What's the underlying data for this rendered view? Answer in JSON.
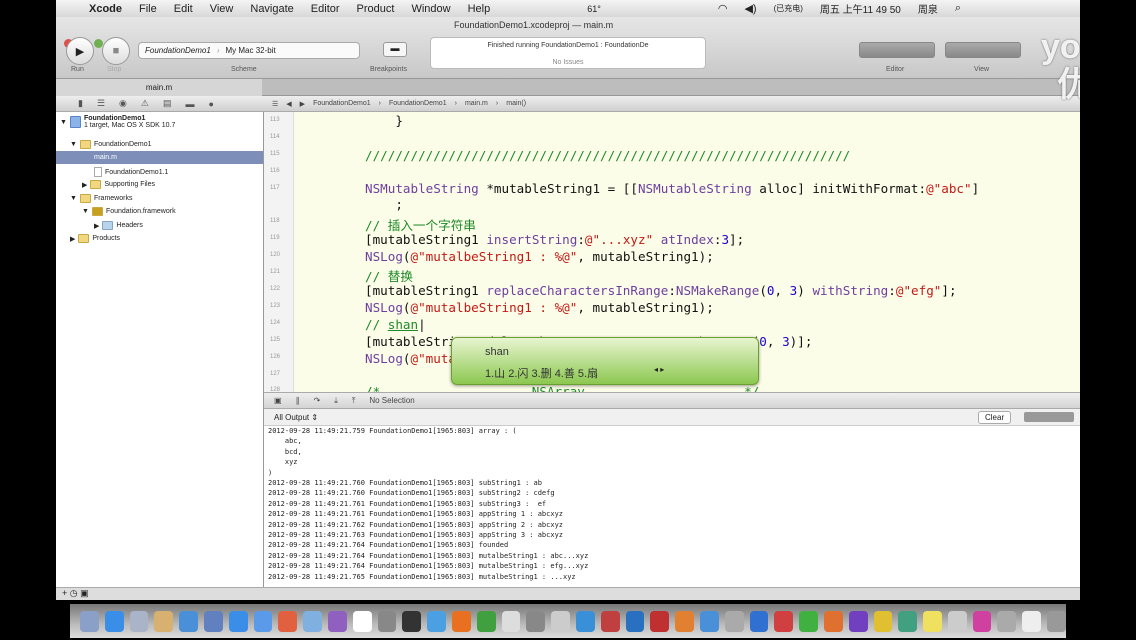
{
  "menubar": {
    "app": "Xcode",
    "items": [
      "File",
      "Edit",
      "View",
      "Navigate",
      "Editor",
      "Product",
      "Window",
      "Help"
    ],
    "temp": "61°",
    "battery": "(已充电)",
    "clock": "周五 上午11 49 50",
    "user": "周泉"
  },
  "window": {
    "title": "FoundationDemo1.xcodeproj — main.m"
  },
  "toolbar": {
    "run": "Run",
    "stop": "Stop",
    "scheme_target": "FoundationDemo1",
    "scheme_dest": "My Mac 32-bit",
    "scheme_label": "Scheme",
    "breakpoints": "Breakpoints",
    "activity_status": "Finished running FoundationDemo1 : FoundationDe",
    "activity_issues": "No Issues",
    "editor": "Editor",
    "view": "View"
  },
  "tab": {
    "label": "main.m"
  },
  "navigator": {
    "project": "FoundationDemo1",
    "project_sub": "1 target, Mac OS X SDK 10.7",
    "items": [
      "FoundationDemo1",
      "main.m",
      "FoundationDemo1.1",
      "Supporting Files",
      "Frameworks",
      "Foundation.framework",
      "Headers",
      "Products"
    ]
  },
  "jumpbar": [
    "FoundationDemo1",
    "FoundationDemo1",
    "main.m",
    "main()"
  ],
  "editor": {
    "line_numbers": [
      "113",
      "114",
      "115",
      "116",
      "117",
      "",
      "118",
      "119",
      "120",
      "121",
      "122",
      "123",
      "124",
      "125",
      "126",
      "127",
      "128"
    ]
  },
  "ime": {
    "input": "shan",
    "candidates": "1.山  2.闪  3.删  4.善  5.扇"
  },
  "debug": {
    "selection": "No Selection"
  },
  "output": {
    "filter": "All Output ⇕",
    "clear": "Clear",
    "lines": [
      "2012-09-28 11:49:21.759 FoundationDemo1[1965:803] array : (",
      "    abc,",
      "    bcd,",
      "    xyz",
      ")",
      "2012-09-28 11:49:21.760 FoundationDemo1[1965:803] subString1 : ab",
      "2012-09-28 11:49:21.760 FoundationDemo1[1965:803] subString2 : cdefg",
      "2012-09-28 11:49:21.761 FoundationDemo1[1965:803] subString3 :  ef",
      "2012-09-28 11:49:21.761 FoundationDemo1[1965:803] appString 1 : abcxyz",
      "2012-09-28 11:49:21.762 FoundationDemo1[1965:803] appString 2 : abcxyz",
      "2012-09-28 11:49:21.763 FoundationDemo1[1965:803] appString 3 : abcxyz",
      "2012-09-28 11:49:21.764 FoundationDemo1[1965:803] founded",
      "2012-09-28 11:49:21.764 FoundationDemo1[1965:803] mutalbeString1 : abc...xyz",
      "2012-09-28 11:49:21.764 FoundationDemo1[1965:803] mutalbeString1 : efg...xyz",
      "2012-09-28 11:49:21.765 FoundationDemo1[1965:803] mutalbeString1 : ...xyz"
    ]
  },
  "watermark": {
    "text1": "youku",
    "text2": "优酷"
  }
}
